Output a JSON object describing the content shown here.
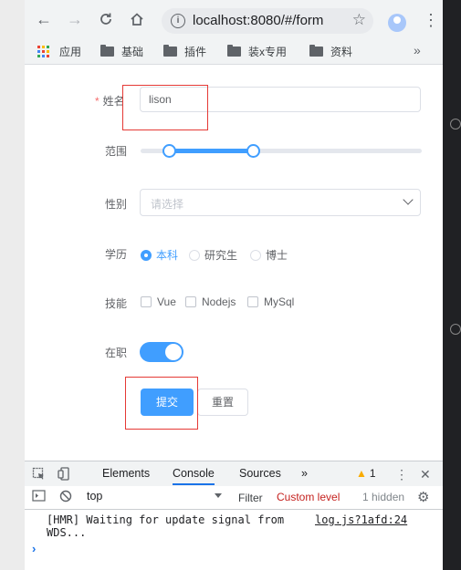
{
  "browser": {
    "url": "localhost:8080/#/form",
    "bookmarks": [
      {
        "label": "应用",
        "icon": "apps-grid-icon"
      },
      {
        "label": "基础",
        "icon": "folder-icon"
      },
      {
        "label": "插件",
        "icon": "folder-icon"
      },
      {
        "label": "装x专用",
        "icon": "folder-icon"
      },
      {
        "label": "资料",
        "icon": "folder-icon"
      }
    ],
    "more": "»"
  },
  "form": {
    "name_label": "姓名",
    "name_value": "lison",
    "range_label": "范围",
    "range_values": [
      10,
      40
    ],
    "range_min": 0,
    "range_max": 100,
    "gender_label": "性别",
    "gender_placeholder": "请选择",
    "education_label": "学历",
    "education_options": [
      "本科",
      "研究生",
      "博士"
    ],
    "education_selected": "本科",
    "skills_label": "技能",
    "skills_options": [
      "Vue",
      "Nodejs",
      "MySql"
    ],
    "employed_label": "在职",
    "employed_on": true,
    "submit_label": "提交",
    "reset_label": "重置"
  },
  "devtools": {
    "tabs": [
      "Elements",
      "Console",
      "Sources"
    ],
    "active_tab": "Console",
    "more_tabs": "»",
    "warning_count": "1",
    "context": "top",
    "filter_placeholder": "Filter",
    "levels": "Custom level",
    "hidden": "1 hidden",
    "log_text_1": "[HMR] Waiting for update signal from",
    "log_text_2": "WDS...",
    "log_source": "log.js?1afd:24",
    "prompt": "›"
  },
  "colors": {
    "primary": "#409eff",
    "required": "#f56c6c",
    "annotation": "#e53935"
  }
}
